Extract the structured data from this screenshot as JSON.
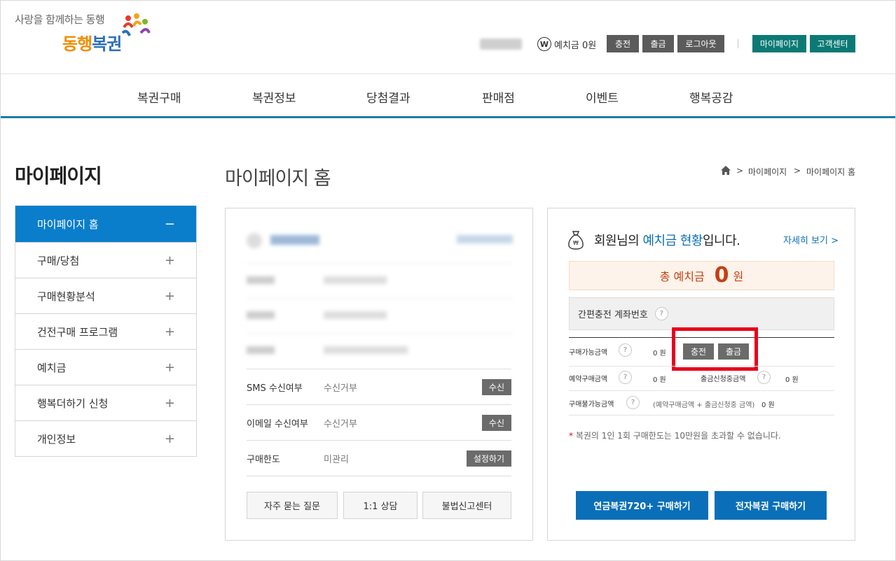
{
  "header": {
    "logo_tagline": "사랑을 함께하는 동행",
    "logo_text_1": "동행",
    "logo_text_2": "복권",
    "deposit_prefix": "예치금",
    "deposit_amount": "0원",
    "buttons": [
      "충전",
      "출금",
      "로그아웃"
    ],
    "links": [
      "마이페이지",
      "고객센터"
    ],
    "won_symbol": "W"
  },
  "nav": [
    "복권구매",
    "복권정보",
    "당첨결과",
    "판매점",
    "이벤트",
    "행복공감"
  ],
  "sidebar": {
    "title": "마이페이지",
    "items": [
      {
        "label": "마이페이지 홈",
        "sign": "−"
      },
      {
        "label": "구매/당첨",
        "sign": "+"
      },
      {
        "label": "구매현황분석",
        "sign": "+"
      },
      {
        "label": "건전구매 프로그램",
        "sign": "+"
      },
      {
        "label": "예치금",
        "sign": "+"
      },
      {
        "label": "행복더하기 신청",
        "sign": "+"
      },
      {
        "label": "개인정보",
        "sign": "+"
      }
    ]
  },
  "main": {
    "title": "마이페이지 홈",
    "breadcrumb": [
      "마이페이지",
      "마이페이지 홈"
    ],
    "breadcrumb_sep": ">"
  },
  "profile": {
    "rows": [
      {
        "label": "SMS 수신여부",
        "value": "수신거부",
        "button": "수신"
      },
      {
        "label": "이메일 수신여부",
        "value": "수신거부",
        "button": "수신"
      },
      {
        "label": "구매한도",
        "value": "미관리",
        "button": "설정하기"
      }
    ],
    "bottom_buttons": [
      "자주 묻는 질문",
      "1:1 상담",
      "불법신고센터"
    ]
  },
  "deposit": {
    "heading_1": "회원님의 ",
    "heading_hl": "예치금 현황",
    "heading_2": "입니다.",
    "detail_link": "자세히 보기 >",
    "total_label": "총 예치금",
    "total_value": "0",
    "total_unit": "원",
    "easy_charge_label": "간편충전 계좌번호",
    "help": "?",
    "rows": {
      "available_label": "구매가능금액",
      "available_value": "0 원",
      "reserved_label": "예약구매금액",
      "reserved_value": "0 원",
      "withdraw_req_label": "출금신청중금액",
      "withdraw_req_value": "0 원",
      "unavailable_label": "구매불가능금액",
      "unavailable_detail": "(예약구매금액 + 출금신청중 금액)",
      "unavailable_value": "0 원"
    },
    "charge_button": "충전",
    "withdraw_button": "출금",
    "note_star": "*",
    "note": " 복권의 1인 1회 구매한도는 10만원을 초과할 수 없습니다.",
    "buy_buttons": [
      "연금복권720+ 구매하기",
      "전자복권 구매하기"
    ]
  }
}
